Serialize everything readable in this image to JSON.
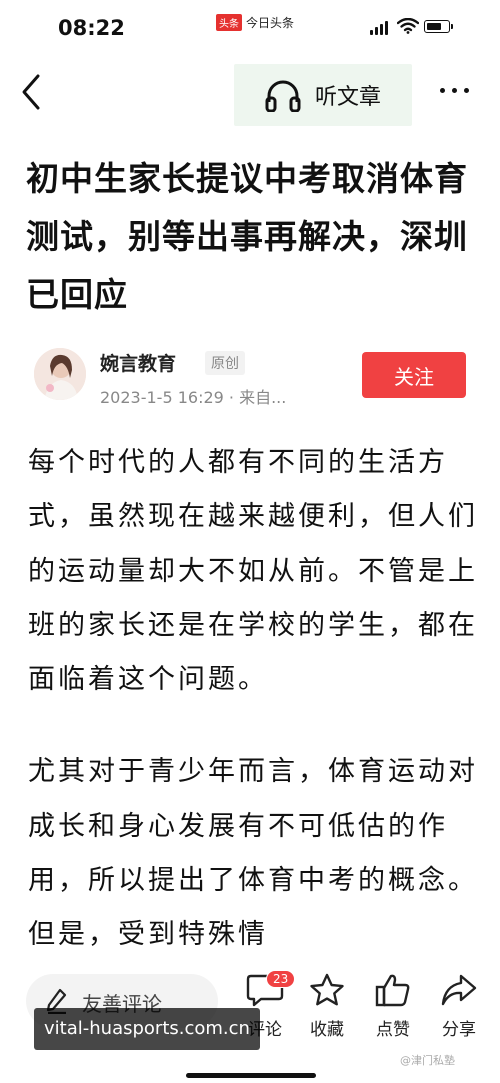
{
  "status": {
    "time": "08:22",
    "app_logo": "头条",
    "app_name": "今日头条"
  },
  "nav": {
    "listen_label": "听文章"
  },
  "article": {
    "title": "初中生家长提议中考取消体育测试，别等出事再解决，深圳已回应",
    "author": "婉言教育",
    "original_tag": "原创",
    "meta": "2023-1-5 16:29 · 来自...",
    "follow_label": "关注",
    "paragraphs": [
      "每个时代的人都有不同的生活方式，虽然现在越来越便利，但人们的运动量却大不如从前。不管是上班的家长还是在学校的学生，都在面临着这个问题。",
      "尤其对于青少年而言，体育运动对成长和身心发展有不可低估的作用，所以提出了体育中考的概念。但是，受到特殊情"
    ]
  },
  "bottom_bar": {
    "comment_placeholder": "友善评论",
    "comment_count": "23",
    "comment_label": "评论",
    "favorite_label": "收藏",
    "like_label": "点赞",
    "share_label": "分享"
  },
  "overlay": {
    "url": "vital-huasports.com.cn",
    "source": "@津门私塾"
  },
  "colors": {
    "accent_red": "#f04142",
    "listen_bg": "#eef6ef"
  },
  "icons": [
    "back-chevron-icon",
    "headphones-icon",
    "more-dots-icon",
    "pen-icon",
    "comment-icon",
    "star-icon",
    "thumbs-up-icon",
    "share-icon"
  ]
}
